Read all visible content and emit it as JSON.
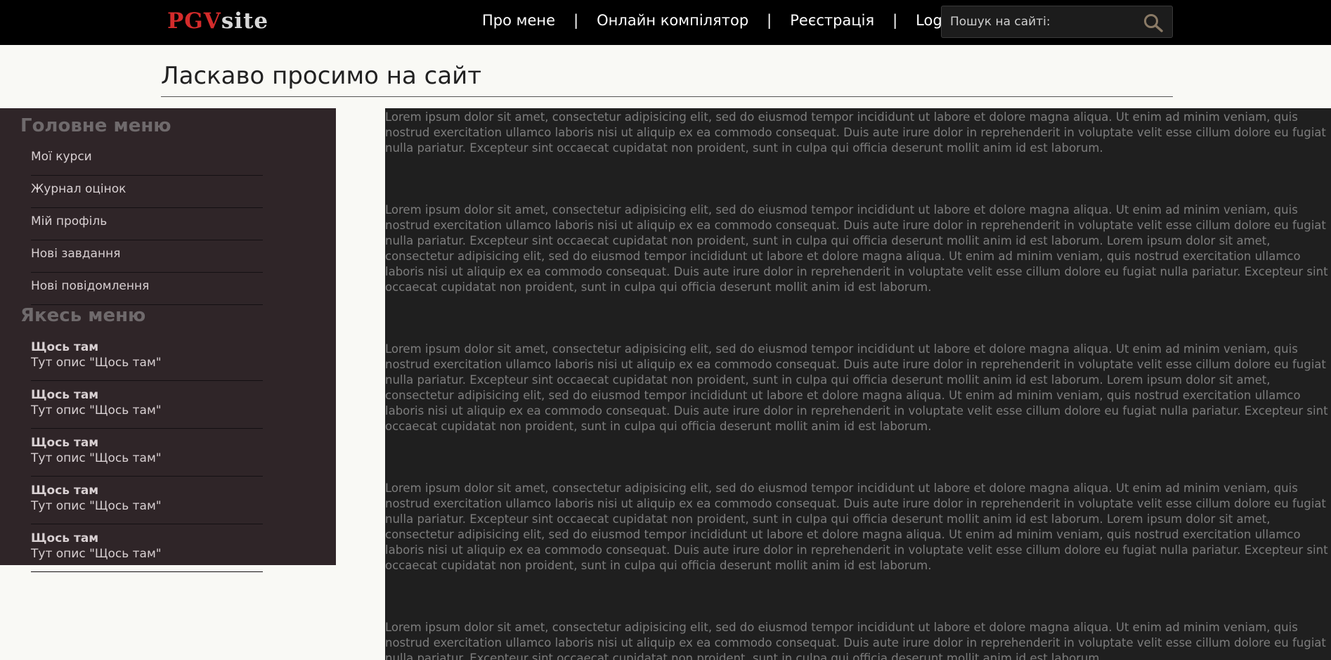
{
  "header": {
    "logo_part1": "PGV",
    "logo_part2": "site",
    "nav": [
      {
        "label": "Про мене"
      },
      {
        "label": "Онлайн компілятор"
      },
      {
        "label": "Реєстрація"
      },
      {
        "label": "Login"
      }
    ],
    "separator": "|",
    "search": {
      "placeholder": "Пошук на сайті:",
      "icon": "search-icon"
    }
  },
  "page_title": "Ласкаво просимо на сайт",
  "sidebar": {
    "main_menu": {
      "heading": "Головне меню",
      "items": [
        {
          "label": "Мої курси"
        },
        {
          "label": "Журнал оцінок"
        },
        {
          "label": "Мій профіль"
        },
        {
          "label": "Нові завдання"
        },
        {
          "label": "Нові повідомлення"
        }
      ]
    },
    "other_menu": {
      "heading": "Якесь меню",
      "items": [
        {
          "title": "Щось там",
          "desc": "Тут опис \"Щось там\""
        },
        {
          "title": "Щось там",
          "desc": "Тут опис \"Щось там\""
        },
        {
          "title": "Щось там",
          "desc": "Тут опис \"Щось там\""
        },
        {
          "title": "Щось там",
          "desc": "Тут опис \"Щось там\""
        },
        {
          "title": "Щось там",
          "desc": "Тут опис \"Щось там\""
        }
      ]
    }
  },
  "content": {
    "paragraphs": [
      "Lorem ipsum dolor sit amet, consectetur adipisicing elit, sed do eiusmod tempor incididunt ut labore et dolore magna aliqua. Ut enim ad minim veniam, quis nostrud exercitation ullamco laboris nisi ut aliquip ex ea commodo consequat. Duis aute irure dolor in reprehenderit in voluptate velit esse cillum dolore eu fugiat nulla pariatur. Excepteur sint occaecat cupidatat non proident, sunt in culpa qui officia deserunt mollit anim id est laborum.",
      "Lorem ipsum dolor sit amet, consectetur adipisicing elit, sed do eiusmod tempor incididunt ut labore et dolore magna aliqua. Ut enim ad minim veniam, quis nostrud exercitation ullamco laboris nisi ut aliquip ex ea commodo consequat. Duis aute irure dolor in reprehenderit in voluptate velit esse cillum dolore eu fugiat nulla pariatur. Excepteur sint occaecat cupidatat non proident, sunt in culpa qui officia deserunt mollit anim id est laborum. Lorem ipsum dolor sit amet, consectetur adipisicing elit, sed do eiusmod tempor incididunt ut labore et dolore magna aliqua. Ut enim ad minim veniam, quis nostrud exercitation ullamco laboris nisi ut aliquip ex ea commodo consequat. Duis aute irure dolor in reprehenderit in voluptate velit esse cillum dolore eu fugiat nulla pariatur. Excepteur sint occaecat cupidatat non proident, sunt in culpa qui officia deserunt mollit anim id est laborum.",
      "Lorem ipsum dolor sit amet, consectetur adipisicing elit, sed do eiusmod tempor incididunt ut labore et dolore magna aliqua. Ut enim ad minim veniam, quis nostrud exercitation ullamco laboris nisi ut aliquip ex ea commodo consequat. Duis aute irure dolor in reprehenderit in voluptate velit esse cillum dolore eu fugiat nulla pariatur. Excepteur sint occaecat cupidatat non proident, sunt in culpa qui officia deserunt mollit anim id est laborum. Lorem ipsum dolor sit amet, consectetur adipisicing elit, sed do eiusmod tempor incididunt ut labore et dolore magna aliqua. Ut enim ad minim veniam, quis nostrud exercitation ullamco laboris nisi ut aliquip ex ea commodo consequat. Duis aute irure dolor in reprehenderit in voluptate velit esse cillum dolore eu fugiat nulla pariatur. Excepteur sint occaecat cupidatat non proident, sunt in culpa qui officia deserunt mollit anim id est laborum.",
      "Lorem ipsum dolor sit amet, consectetur adipisicing elit, sed do eiusmod tempor incididunt ut labore et dolore magna aliqua. Ut enim ad minim veniam, quis nostrud exercitation ullamco laboris nisi ut aliquip ex ea commodo consequat. Duis aute irure dolor in reprehenderit in voluptate velit esse cillum dolore eu fugiat nulla pariatur. Excepteur sint occaecat cupidatat non proident, sunt in culpa qui officia deserunt mollit anim id est laborum. Lorem ipsum dolor sit amet, consectetur adipisicing elit, sed do eiusmod tempor incididunt ut labore et dolore magna aliqua. Ut enim ad minim veniam, quis nostrud exercitation ullamco laboris nisi ut aliquip ex ea commodo consequat. Duis aute irure dolor in reprehenderit in voluptate velit esse cillum dolore eu fugiat nulla pariatur. Excepteur sint occaecat cupidatat non proident, sunt in culpa qui officia deserunt mollit anim id est laborum.",
      "Lorem ipsum dolor sit amet, consectetur adipisicing elit, sed do eiusmod tempor incididunt ut labore et dolore magna aliqua. Ut enim ad minim veniam, quis nostrud exercitation ullamco laboris nisi ut aliquip ex ea commodo consequat. Duis aute irure dolor in reprehenderit in voluptate velit esse cillum dolore eu fugiat nulla pariatur. Excepteur sint occaecat cupidatat non proident, sunt in culpa qui officia deserunt mollit anim id est laborum."
    ]
  },
  "colors": {
    "topbar": "#000000",
    "logo_accent": "#d42b2b",
    "sidebar_bg": "#2f2528",
    "content_bg": "#1f1f1f",
    "page_bg": "#f9f9f5"
  }
}
